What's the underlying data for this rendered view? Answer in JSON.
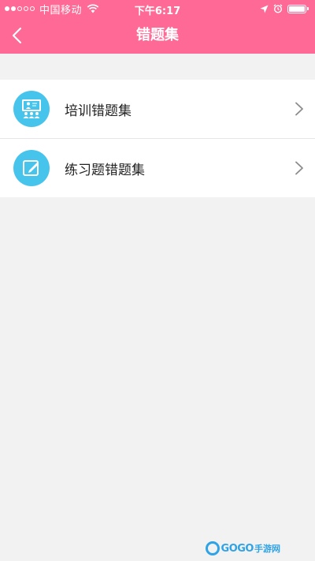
{
  "status_bar": {
    "carrier": "中国移动",
    "time": "下午6:17"
  },
  "nav": {
    "title": "错题集",
    "back_icon": "chevron-left-icon"
  },
  "list": [
    {
      "label": "培训错题集",
      "icon": "training-class-icon"
    },
    {
      "label": "练习题错题集",
      "icon": "pencil-edit-icon"
    }
  ],
  "watermark": {
    "brand_a": "GO",
    "brand_b": "GO",
    "brand_cn": "手游网"
  },
  "colors": {
    "accent": "#fe6a95",
    "icon_bg": "#46c4ec",
    "background": "#f2f2f2"
  }
}
